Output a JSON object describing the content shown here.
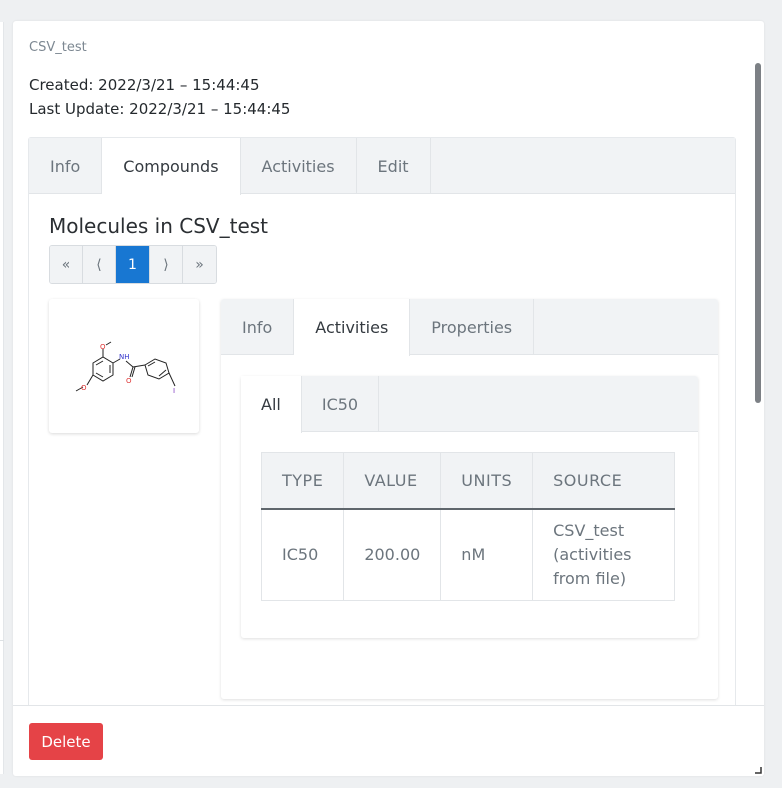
{
  "dialog": {
    "title": "CSV_test",
    "created": "Created: 2022/3/21 – 15:44:45",
    "updated": "Last Update: 2022/3/21 – 15:44:45"
  },
  "main_tabs": [
    "Info",
    "Compounds",
    "Activities",
    "Edit"
  ],
  "compounds": {
    "heading": "Molecules in CSV_test",
    "pager": {
      "first": "«",
      "prev": "⟨",
      "current": "1",
      "next": "⟩",
      "last": "»"
    }
  },
  "molecule_tabs": [
    "Info",
    "Activities",
    "Properties"
  ],
  "activity_tabs": [
    "All",
    "IC50"
  ],
  "table": {
    "headers": [
      "TYPE",
      "VALUE",
      "UNITS",
      "SOURCE"
    ],
    "rows": [
      {
        "type": "IC50",
        "value": "200.00",
        "units": "nM",
        "source": "CSV_test (activities from file)"
      }
    ]
  },
  "footer": {
    "delete_label": "Delete"
  },
  "colors": {
    "primary": "#1877d2",
    "danger": "#e54347"
  }
}
